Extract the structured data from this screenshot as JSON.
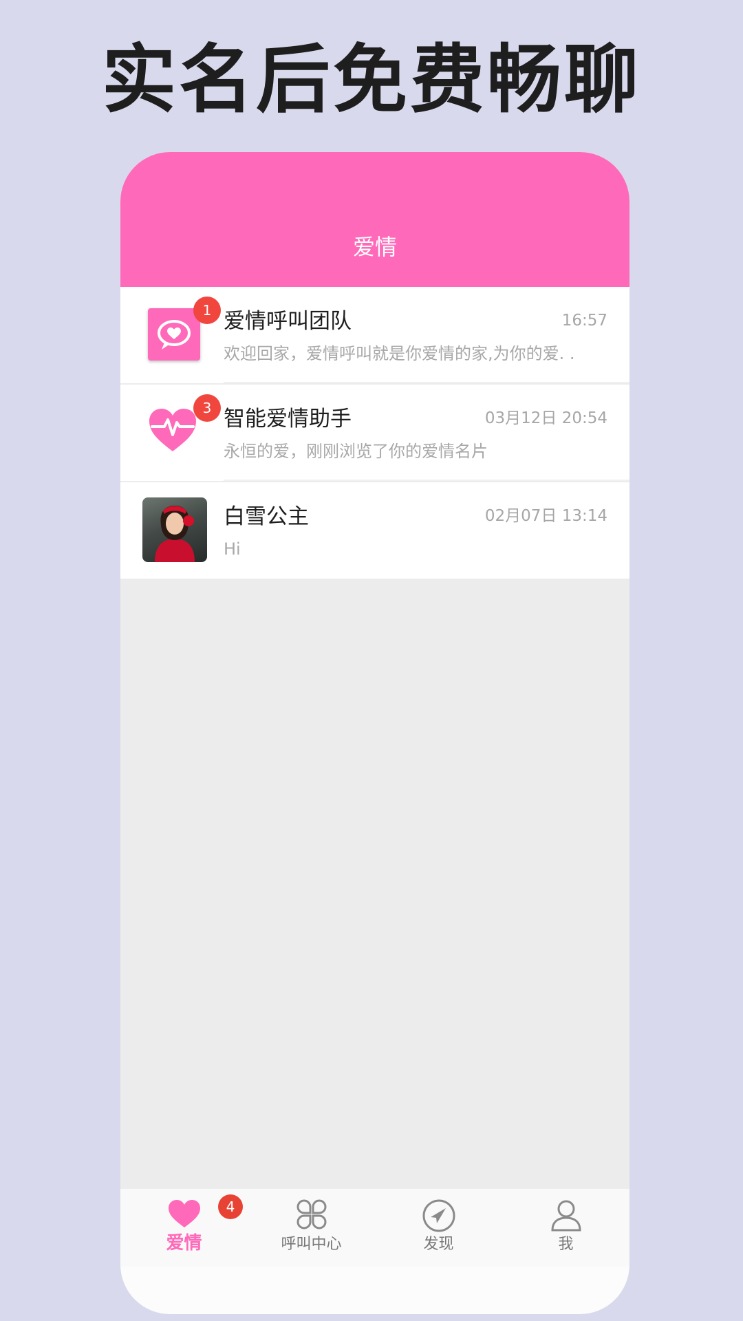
{
  "headline": "实名后免费畅聊",
  "app": {
    "title": "爱情"
  },
  "conversations": [
    {
      "name": "爱情呼叫团队",
      "time": "16:57",
      "preview": "欢迎回家，爱情呼叫就是你爱情的家,为你的爱. .",
      "badge": "1",
      "avatar_icon": "chat-heart-icon"
    },
    {
      "name": "智能爱情助手",
      "time": "03月12日 20:54",
      "preview": "永恒的爱，刚刚浏览了你的爱情名片",
      "badge": "3",
      "avatar_icon": "heartbeat-icon"
    },
    {
      "name": "白雪公主",
      "time": "02月07日 13:14",
      "preview": "Hi",
      "avatar_icon": "user-photo"
    }
  ],
  "tabbar": {
    "items": [
      {
        "label": "爱情",
        "icon": "heart-icon",
        "active": true,
        "badge": "4"
      },
      {
        "label": "呼叫中心",
        "icon": "grid-icon",
        "active": false
      },
      {
        "label": "发现",
        "icon": "compass-icon",
        "active": false
      },
      {
        "label": "我",
        "icon": "user-icon",
        "active": false
      }
    ]
  },
  "colors": {
    "accent": "#ff69b9",
    "badge": "#f0463e",
    "background": "#d8d9ec"
  }
}
